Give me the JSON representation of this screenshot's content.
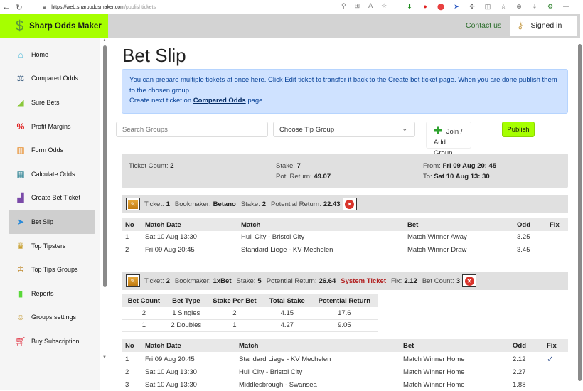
{
  "browser": {
    "url_host": "https://web.sharpoddsmaker.com",
    "url_path": "/publishtickets"
  },
  "header": {
    "brand": "Sharp Odds Maker",
    "contact": "Contact us",
    "signed_in": "Signed in"
  },
  "sidebar": {
    "items": [
      {
        "label": "Home",
        "icon": "home-icon"
      },
      {
        "label": "Compared Odds",
        "icon": "scale-icon"
      },
      {
        "label": "Sure Bets",
        "icon": "chart-up-icon"
      },
      {
        "label": "Profit Margins",
        "icon": "percent-icon"
      },
      {
        "label": "Form Odds",
        "icon": "bar-chart-icon"
      },
      {
        "label": "Calculate Odds",
        "icon": "calculator-icon"
      },
      {
        "label": "Create Bet Ticket",
        "icon": "ticket-icon"
      },
      {
        "label": "Bet Slip",
        "icon": "paper-plane-icon",
        "active": true
      },
      {
        "label": "Top Tipsters",
        "icon": "crown-ball-icon"
      },
      {
        "label": "Top Tips Groups",
        "icon": "crown-groups-icon"
      },
      {
        "label": "Reports",
        "icon": "reports-icon"
      },
      {
        "label": "Groups settings",
        "icon": "users-settings-icon"
      },
      {
        "label": "Buy Subscription",
        "icon": "cart-icon"
      }
    ]
  },
  "page": {
    "title": "Bet Slip",
    "alert": {
      "line1": "You can prepare multiple tickets at once here. Click Edit ticket to transfer it back to the Create bet ticket page. When you are done publish them to the chosen group.",
      "line2_prefix": "Create next ticket on ",
      "line2_link": "Compared Odds",
      "line2_suffix": " page."
    },
    "search_placeholder": "Search Groups",
    "select_value": "Choose Tip Group",
    "join_label": "Join / Add Group",
    "publish_label": "Publish",
    "summary": {
      "ticket_count_label": "Ticket Count: ",
      "ticket_count": "2",
      "stake_label": "Stake: ",
      "stake": "7",
      "pot_return_label": "Pot. Return: ",
      "pot_return": "49.07",
      "from_label": "From: ",
      "from": "Fri 09 Aug 20: 45",
      "to_label": "To: ",
      "to": "Sat 10 Aug 13: 30"
    },
    "bet_columns": [
      "No",
      "Match Date",
      "Match",
      "Bet",
      "Odd",
      "Fix"
    ],
    "tickets": [
      {
        "ticket_label": "Ticket:",
        "ticket": "1",
        "bookmaker_label": "Bookmaker:",
        "bookmaker": "Betano",
        "stake_label": "Stake:",
        "stake": "2",
        "return_label": "Potential Return:",
        "return": "22.43",
        "rows": [
          {
            "no": "1",
            "date": "Sat 10 Aug 13:30",
            "match": "Hull City - Bristol City",
            "bet": "Match Winner Away",
            "odd": "3.25",
            "fix": ""
          },
          {
            "no": "2",
            "date": "Fri 09 Aug 20:45",
            "match": "Standard Liege - KV Mechelen",
            "bet": "Match Winner Draw",
            "odd": "3.45",
            "fix": ""
          }
        ]
      },
      {
        "ticket_label": "Ticket:",
        "ticket": "2",
        "bookmaker_label": "Bookmaker:",
        "bookmaker": "1xBet",
        "stake_label": "Stake:",
        "stake": "5",
        "return_label": "Potential Return:",
        "return": "26.64",
        "system_label": "System Ticket",
        "fix_label": "Fix:",
        "fix": "2.12",
        "bet_count_label": "Bet Count:",
        "bet_count": "3",
        "system_columns": [
          "Bet Count",
          "Bet Type",
          "Stake Per Bet",
          "Total Stake",
          "Potential Return"
        ],
        "system_rows": [
          [
            "2",
            "1 Singles",
            "2",
            "4.15",
            "17.6"
          ],
          [
            "1",
            "2 Doubles",
            "1",
            "4.27",
            "9.05"
          ]
        ],
        "rows": [
          {
            "no": "1",
            "date": "Fri 09 Aug 20:45",
            "match": "Standard Liege - KV Mechelen",
            "bet": "Match Winner Home",
            "odd": "2.12",
            "fix": "✓"
          },
          {
            "no": "2",
            "date": "Sat 10 Aug 13:30",
            "match": "Hull City - Bristol City",
            "bet": "Match Winner Home",
            "odd": "2.27",
            "fix": ""
          },
          {
            "no": "3",
            "date": "Sat 10 Aug 13:30",
            "match": "Middlesbrough - Swansea",
            "bet": "Match Winner Home",
            "odd": "1.88",
            "fix": ""
          }
        ]
      }
    ]
  }
}
